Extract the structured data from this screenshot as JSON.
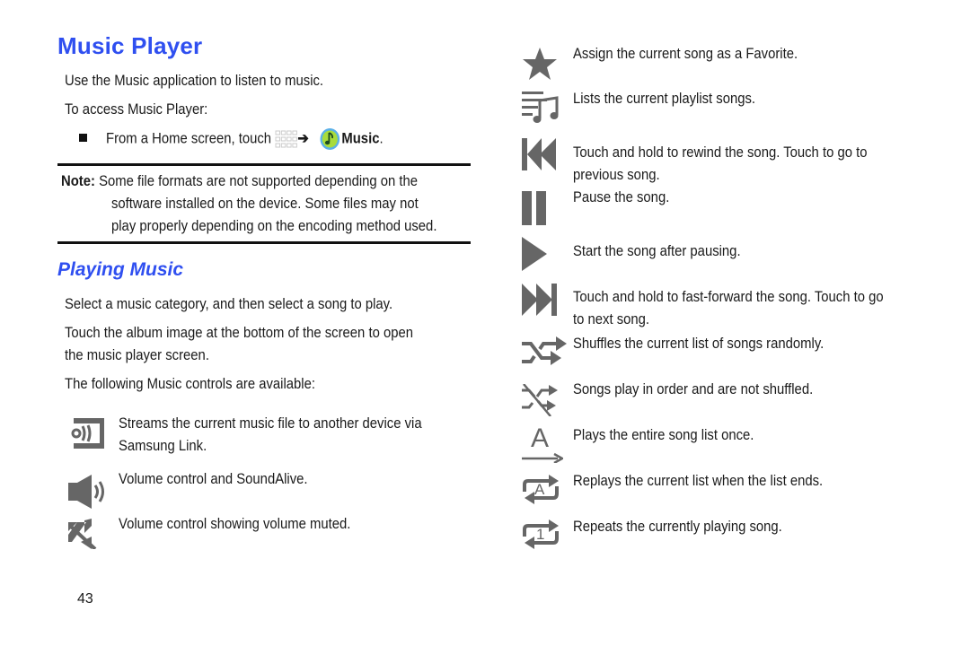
{
  "title": "Music Player",
  "intro": "Use the Music application to listen to music.",
  "access_label": "To access Music Player:",
  "bullet": {
    "text_before": "From a Home screen, touch",
    "arrow": "➔",
    "app_name": "Music",
    "period": "."
  },
  "note": {
    "label": "Note:",
    "line1": "Some file formats are not supported depending on the",
    "line2": "software installed on the device. Some files may not",
    "line3": "play properly depending on the encoding method used."
  },
  "section_title": "Playing Music",
  "para1": "Select a music category, and then select a song to play.",
  "para2_line1": "Touch the album image at the bottom of the screen to open",
  "para2_line2": "the music player screen.",
  "para3": "The following Music controls are available:",
  "left_controls": [
    {
      "icon": "samsung-link-icon",
      "line1": "Streams the current music file to another device via",
      "line2": "Samsung Link."
    },
    {
      "icon": "volume-icon",
      "line1": "Volume control and SoundAlive."
    },
    {
      "icon": "volume-muted-icon",
      "line1": "Volume control showing volume muted."
    }
  ],
  "right_controls": [
    {
      "icon": "star-icon",
      "line1": "Assign the current song as a Favorite."
    },
    {
      "icon": "playlist-icon",
      "line1": "Lists the current playlist songs."
    },
    {
      "icon": "rewind-icon",
      "line1": "Touch and hold to rewind the song. Touch to go to",
      "line2": "previous song."
    },
    {
      "icon": "pause-icon",
      "line1": "Pause the song."
    },
    {
      "icon": "play-icon",
      "line1": "Start the song after pausing."
    },
    {
      "icon": "fast-forward-icon",
      "line1": "Touch and hold to fast-forward the song. Touch to go",
      "line2": "to next song."
    },
    {
      "icon": "shuffle-on-icon",
      "line1": "Shuffles the current list of songs randomly."
    },
    {
      "icon": "shuffle-off-icon",
      "line1": "Songs play in order and are not shuffled."
    },
    {
      "icon": "play-once-icon",
      "line1": "Plays the entire song list once.",
      "glyph": "A"
    },
    {
      "icon": "repeat-all-icon",
      "line1": "Replays the current list when the list ends.",
      "glyph": "A"
    },
    {
      "icon": "repeat-one-icon",
      "line1": "Repeats the currently playing song.",
      "glyph": "1"
    }
  ],
  "page_number": "43",
  "colors": {
    "heading": "#2f4ff0",
    "icon_gray": "#666666"
  }
}
